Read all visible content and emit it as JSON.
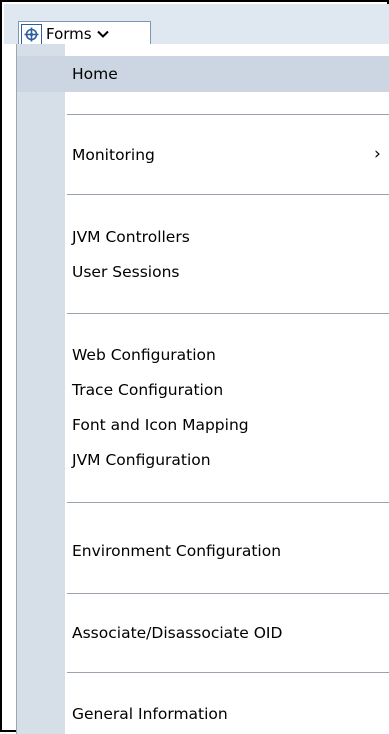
{
  "menubar": {
    "forms_label": "Forms",
    "icon": "target-icon",
    "dropdown_icon": "chevron-down-icon"
  },
  "menu": {
    "home": "Home",
    "monitoring": "Monitoring",
    "submenu_arrow": "›",
    "jvm_controllers": "JVM Controllers",
    "user_sessions": "User Sessions",
    "web_configuration": "Web Configuration",
    "trace_configuration": "Trace Configuration",
    "font_icon_mapping": "Font and Icon Mapping",
    "jvm_configuration": "JVM Configuration",
    "environment_configuration": "Environment Configuration",
    "associate_oid": "Associate/Disassociate OID",
    "general_information": "General Information"
  },
  "colors": {
    "menubar_bg": "#dfe7f1",
    "gutter_bg": "#d6dee7",
    "highlight_bg": "#ccd6e2",
    "icon_border": "#2f5f9e"
  }
}
